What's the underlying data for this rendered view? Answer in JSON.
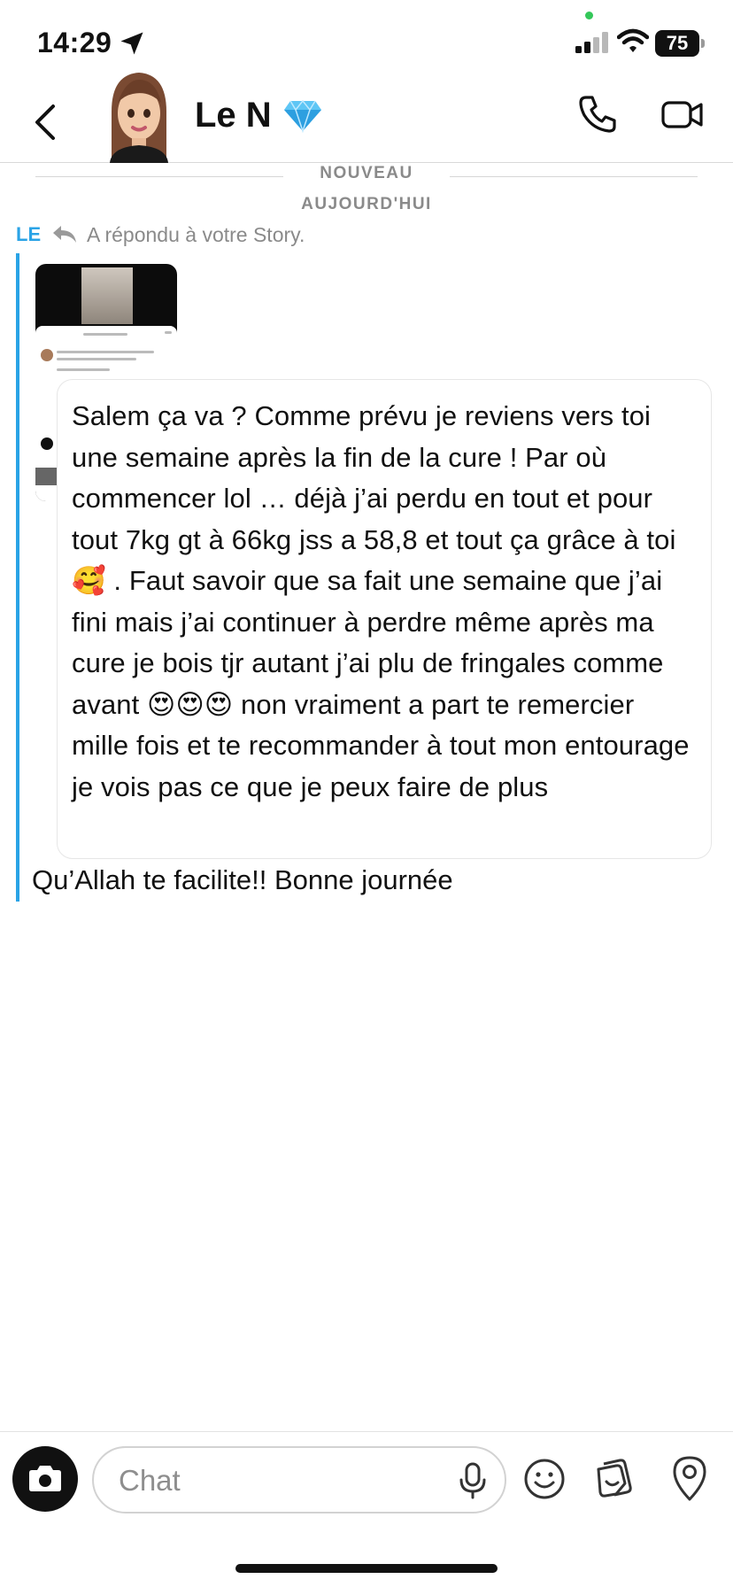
{
  "status_bar": {
    "time": "14:29",
    "battery": "75",
    "icons": [
      "location-arrow-icon",
      "signal-icon",
      "wifi-icon",
      "battery-icon"
    ]
  },
  "header": {
    "contact_name": "Le N",
    "badge_icon": "diamond-icon",
    "call_icon": "phone-icon",
    "video_icon": "video-camera-icon"
  },
  "dividers": {
    "new": "NOUVEAU",
    "today": "AUJOURD'HUI"
  },
  "reply": {
    "sender": "LE",
    "text": "A répondu à votre Story."
  },
  "messages": {
    "quoted_reply": "Salem ça va ? Comme prévu je reviens vers toi une semaine après la fin de la cure ! Par où commencer lol … déjà j’ai perdu en tout et pour tout 7kg gt à 66kg jss a 58,8 et tout ça grâce à toi 🥰 . Faut savoir que sa fait une semaine que j’ai fini mais j’ai continuer à perdre même après ma cure je bois tjr autant j’ai plu de fringales comme avant 😍😍😍 non vraiment a part te remercier mille fois et te recommander à tout mon entourage je vois pas ce que je peux faire de plus",
    "followup": "Qu’Allah te facilite!! Bonne journée"
  },
  "composer": {
    "placeholder": "Chat",
    "icons": [
      "camera-icon",
      "microphone-icon",
      "emoji-icon",
      "sticker-icon",
      "location-pin-icon"
    ]
  },
  "colors": {
    "accent_blue": "#2aa3e6",
    "status_green": "#34c759"
  }
}
